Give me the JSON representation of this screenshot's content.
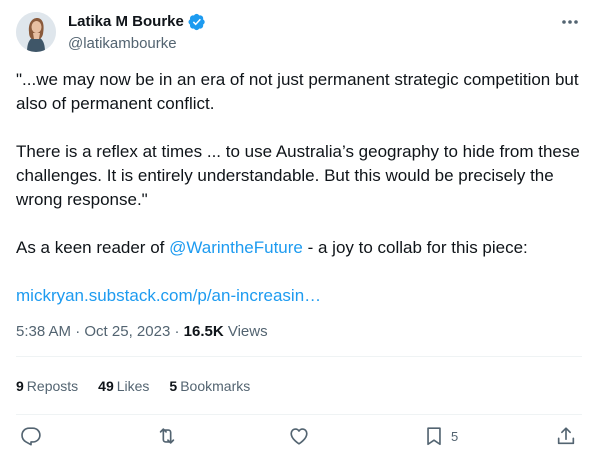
{
  "author": {
    "display_name": "Latika M Bourke",
    "handle": "@latikambourke"
  },
  "tweet": {
    "paragraph_1": "\"...we may now be in an era of not just permanent strategic competition but also of permanent conflict.",
    "paragraph_2": "There is a reflex at times ... to use Australia’s geography to hide from these challenges. It is entirely understandable. But this would be precisely the wrong response.\"",
    "paragraph_3_prefix": "As a keen reader of ",
    "mention": "@WarintheFuture",
    "paragraph_3_suffix": " - a joy to collab for this piece:",
    "link": "mickryan.substack.com/p/an-increasin…"
  },
  "meta": {
    "time": "5:38 AM",
    "separator": " · ",
    "date": "Oct 25, 2023",
    "separator2": " · ",
    "views_count": "16.5K",
    "views_label": " Views"
  },
  "stats": {
    "reposts_count": "9",
    "reposts_label": "Reposts",
    "likes_count": "49",
    "likes_label": "Likes",
    "bookmarks_count": "5",
    "bookmarks_label": "Bookmarks"
  },
  "actions": {
    "bookmark_count": "5"
  },
  "colors": {
    "link": "#1d9bf0",
    "verified": "#1d9bf0",
    "secondary_text": "#536471"
  }
}
